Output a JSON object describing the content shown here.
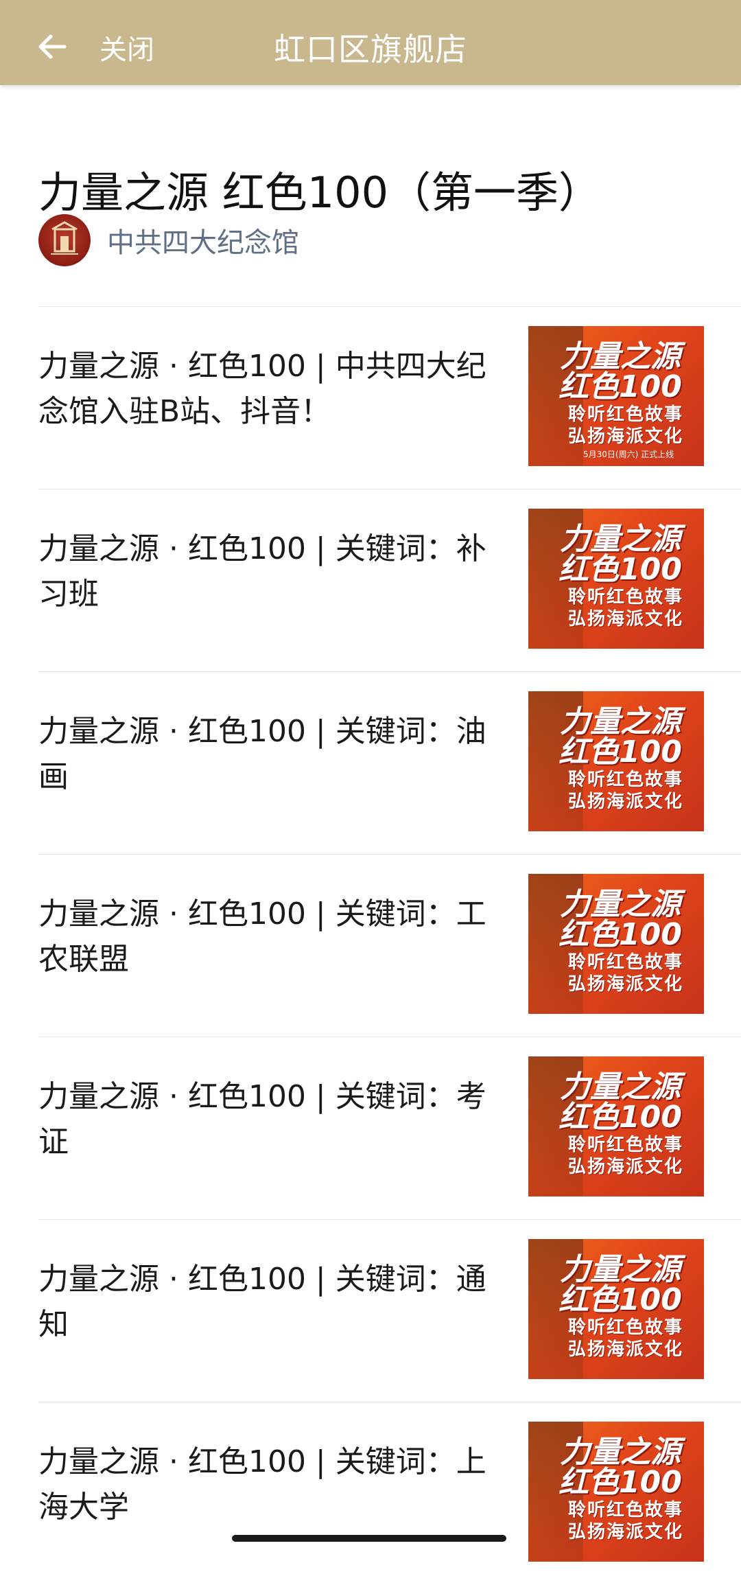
{
  "header": {
    "close_label": "关闭",
    "title": "虹口区旗舰店"
  },
  "article": {
    "title": "力量之源 红色100（第一季）",
    "author": "中共四大纪念馆"
  },
  "thumbnail": {
    "line1": "力量之源",
    "line2": "红色100",
    "line3": "聆听红色故事",
    "line4": "弘扬海派文化",
    "date_note": "5月30日(周六) 正式上线"
  },
  "items": [
    {
      "text": "力量之源 · 红色100 | 中共四大纪念馆入驻B站、抖音！",
      "has_date": true
    },
    {
      "text": "力量之源 · 红色100 | 关键词：补习班"
    },
    {
      "text": "力量之源 · 红色100 | 关键词：油画"
    },
    {
      "text": "力量之源 · 红色100 | 关键词：工农联盟"
    },
    {
      "text": "力量之源 · 红色100 | 关键词：考证"
    },
    {
      "text": "力量之源 · 红色100 | 关键词：通知"
    },
    {
      "text": "力量之源 · 红色100 | 关键词：上海大学"
    }
  ]
}
